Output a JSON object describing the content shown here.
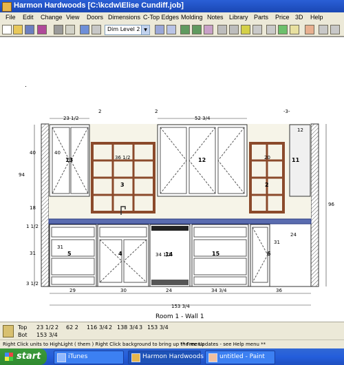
{
  "window": {
    "title": "Harmon Hardwoods [C:\\kcdw\\Elise Cundiff.job]"
  },
  "menu": [
    "File",
    "Edit",
    "Change",
    "View",
    "Doors",
    "Dimensions",
    "C-Top Edges",
    "Molding",
    "Notes",
    "Library",
    "Parts",
    "Price",
    "3D",
    "Help"
  ],
  "toolbar": {
    "dim_level": "Dim Level 2"
  },
  "drawing": {
    "caption": "Room 1 - Wall 1",
    "top_labels": [
      "23 1/2",
      "2",
      "2",
      "52 3/4",
      "-3-"
    ],
    "left_labels": [
      "94",
      "40",
      "18",
      "1 1/2",
      "31",
      "3 1/2"
    ],
    "right_labels": [
      "96",
      "12",
      "24",
      "31"
    ],
    "bottom_labels": [
      "29",
      "30",
      "24",
      "34 3/4",
      "36"
    ],
    "total_width": "153 3/4",
    "inner_labels": {
      "unit13_w": "40",
      "unit3_w": "36 1/2",
      "unit2_w": "20",
      "range_w": "34 1/2",
      "base_w": "31"
    },
    "unit_numbers": [
      "13",
      "3",
      "12",
      "2",
      "11",
      "5",
      "4",
      "14",
      "15",
      "6"
    ]
  },
  "status": {
    "top_label": "Top",
    "top_values": [
      "23 1/2",
      "2",
      "62 2",
      "116 3/4",
      "2",
      "138 3/4",
      "3",
      "153 3/4"
    ],
    "bot_label": "Bot",
    "bot_values": [
      "153 3/4"
    ]
  },
  "hint": {
    "left": "Right Click units to HighLight ( them )   Right Click background to bring up the menu",
    "right": "** Free Updates - see Help menu **"
  },
  "taskbar": {
    "start": "start",
    "tasks": [
      "iTunes",
      "Harmon Hardwoods [...]",
      "untitled - Paint"
    ]
  }
}
